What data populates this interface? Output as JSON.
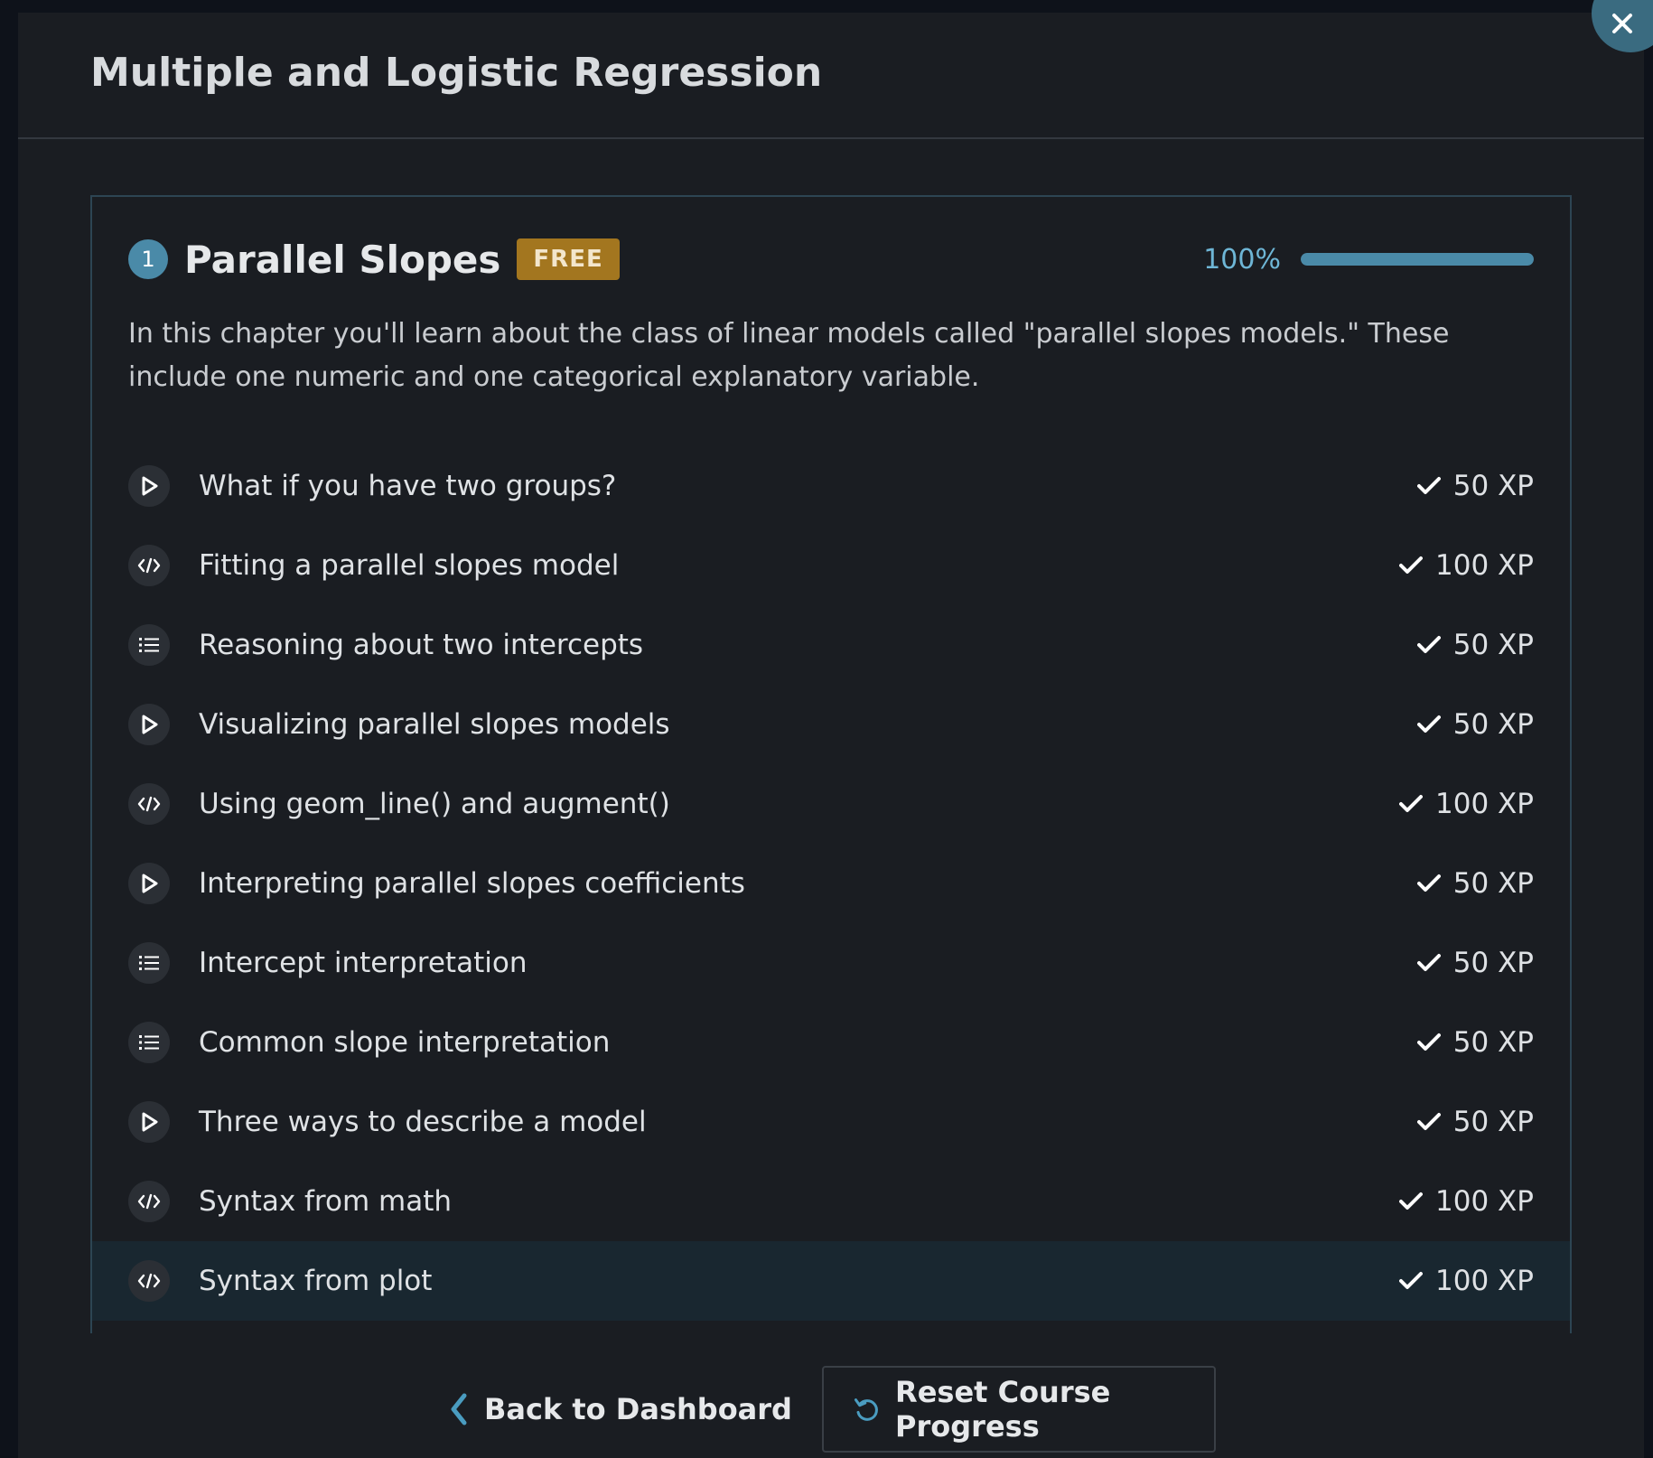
{
  "modal": {
    "title": "Multiple and Logistic Regression"
  },
  "chapter": {
    "number": "1",
    "title": "Parallel Slopes",
    "badge": "FREE",
    "progress_label": "100%",
    "progress_value": 1.0,
    "description": "In this chapter you'll learn about the class of linear models called \"parallel slopes models.\" These include one numeric and one categorical explanatory variable."
  },
  "exercises": [
    {
      "type": "video",
      "icon": "play-icon",
      "title": "What if you have two groups?",
      "xp": "50 XP",
      "completed": true
    },
    {
      "type": "code",
      "icon": "code-icon",
      "title": "Fitting a parallel slopes model",
      "xp": "100 XP",
      "completed": true
    },
    {
      "type": "multiple-choice",
      "icon": "list-icon",
      "title": "Reasoning about two intercepts",
      "xp": "50 XP",
      "completed": true
    },
    {
      "type": "video",
      "icon": "play-icon",
      "title": "Visualizing parallel slopes models",
      "xp": "50 XP",
      "completed": true
    },
    {
      "type": "code",
      "icon": "code-icon",
      "title": "Using geom_line() and augment()",
      "xp": "100 XP",
      "completed": true
    },
    {
      "type": "video",
      "icon": "play-icon",
      "title": "Interpreting parallel slopes coefficients",
      "xp": "50 XP",
      "completed": true
    },
    {
      "type": "multiple-choice",
      "icon": "list-icon",
      "title": "Intercept interpretation",
      "xp": "50 XP",
      "completed": true
    },
    {
      "type": "multiple-choice",
      "icon": "list-icon",
      "title": "Common slope interpretation",
      "xp": "50 XP",
      "completed": true
    },
    {
      "type": "video",
      "icon": "play-icon",
      "title": "Three ways to describe a model",
      "xp": "50 XP",
      "completed": true
    },
    {
      "type": "code",
      "icon": "code-icon",
      "title": "Syntax from math",
      "xp": "100 XP",
      "completed": true
    },
    {
      "type": "code",
      "icon": "code-icon",
      "title": "Syntax from plot",
      "xp": "100 XP",
      "completed": true,
      "active": true
    }
  ],
  "footer": {
    "back_label": "Back to Dashboard",
    "reset_label": "Reset Course Progress"
  },
  "colors": {
    "accent": "#4a8aa8",
    "badge": "#a3761f",
    "background": "#1a1d22",
    "active_row": "#192730"
  }
}
